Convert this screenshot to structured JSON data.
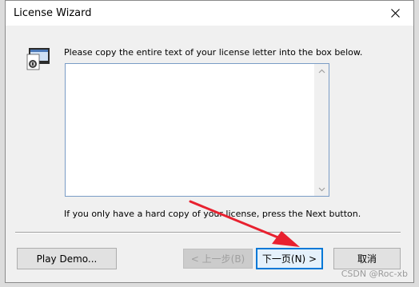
{
  "window": {
    "title": "License Wizard"
  },
  "instruction": "Please copy the entire text of your license letter into the box below.",
  "license_box": {
    "value": ""
  },
  "hard_copy_note": "If you only have a hard copy of your license, press the Next button.",
  "buttons": {
    "play_demo": "Play Demo...",
    "back": "< 上一步(B)",
    "next": "下一页(N) >",
    "cancel": "取消"
  },
  "watermark": "CSDN @Roc-xb",
  "colors": {
    "accent": "#0078d7",
    "annotation_arrow": "#e8212f"
  }
}
